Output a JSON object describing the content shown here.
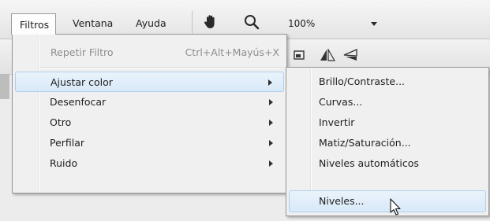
{
  "menubar": {
    "items": [
      "Filtros",
      "Ventana",
      "Ayuda"
    ],
    "zoom": "100%"
  },
  "filtros_menu": {
    "repeat": {
      "label": "Repetir Filtro",
      "shortcut": "Ctrl+Alt+Mayús+X"
    },
    "items": [
      "Ajustar color",
      "Desenfocar",
      "Otro",
      "Perfilar",
      "Ruido"
    ]
  },
  "submenu": {
    "items": [
      "Brillo/Contraste...",
      "Curvas...",
      "Invertir",
      "Matiz/Saturación...",
      "Niveles automáticos",
      "Niveles..."
    ]
  },
  "icons": {
    "hand": "hand-tool-icon",
    "zoom": "magnifier-icon",
    "dropdown": "dropdown-arrow-icon",
    "flip_h": "flip-horizontal-icon",
    "flip_v": "flip-vertical-icon",
    "image": "image-icon",
    "cursor": "mouse-cursor-icon"
  },
  "colors": {
    "highlight": "#d9e9f8",
    "highlight_border": "#aecff0",
    "menu_bg": "#f0f0f0"
  }
}
